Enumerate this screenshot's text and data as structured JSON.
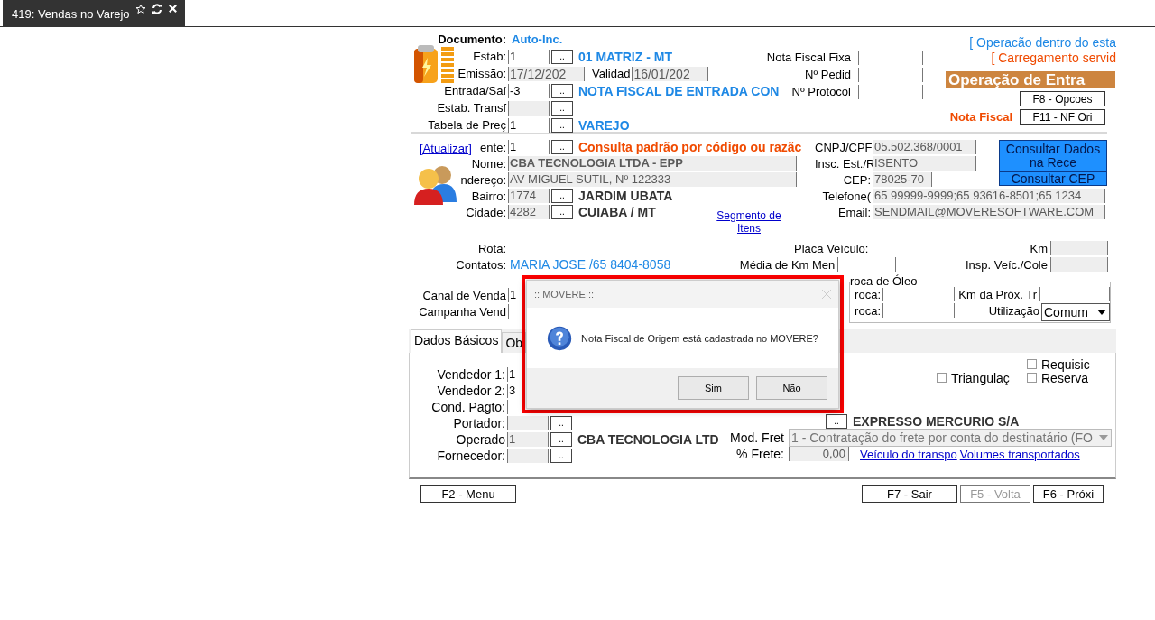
{
  "tab": {
    "title": "419: Vendas no Varejo"
  },
  "document": {
    "label": "Documento:",
    "value": "Auto-Inc."
  },
  "header": {
    "rows": [
      {
        "kind": "lookup",
        "label": "Estab:",
        "value": "1",
        "disabled": false,
        "button": "..",
        "description": "01 MATRIZ - MT",
        "color": "#1e88e5"
      },
      {
        "kind": "pair",
        "label": "Emissão:",
        "value": "17/12/202",
        "disabled": true,
        "label_2": "Validad",
        "value_2": "16/01/202"
      },
      {
        "kind": "lookup",
        "label": "Entrada/Saí",
        "value": "-3",
        "disabled": false,
        "button": "..",
        "description": "NOTA FISCAL DE ENTRADA CON",
        "color": "#1e88e5"
      },
      {
        "kind": "lookup",
        "label": "Estab. Transf",
        "disabled": true,
        "button": ".."
      },
      {
        "kind": "lookup",
        "label": "Tabela de Preç",
        "value": "1",
        "disabled": false,
        "button": "..",
        "description": "VAREJO",
        "color": "#1e88e5"
      }
    ],
    "fiscal_fields": [
      {
        "label": "Nota  Fiscal Fixa"
      },
      {
        "label": "Nº Pedid"
      },
      {
        "label": "Nº Protocol"
      }
    ],
    "notices": [
      {
        "text": "[ Operacão dentro do esta",
        "color": "#1e88e5"
      },
      {
        "text": "[ Carregamento servid",
        "color": "#f04a00"
      }
    ],
    "banner": "Operação de Entra",
    "options_button": "F8 - Opcoes",
    "nf_label": "Nota Fiscal",
    "nf_button": "F11 - NF Ori"
  },
  "customer": {
    "refresh_link": "[Atualizar]",
    "segment_link": "Segmento de Itens",
    "rows": [
      {
        "kind": "lookup",
        "label": "ente:",
        "value": "1",
        "disabled": false,
        "button": "..",
        "description": "Consulta padrão por código ou razãc",
        "color": "#f04a00"
      },
      {
        "kind": "wide",
        "label": "Nome:",
        "value": "CBA TECNOLOGIA LTDA - EPP",
        "disabled": true,
        "bold": true
      },
      {
        "kind": "wide",
        "label": "ndereço:",
        "value": "AV MIGUEL SUTIL, Nº 122333",
        "disabled": true,
        "bold": false
      },
      {
        "kind": "lookup",
        "label": "Bairro:",
        "value": "1774",
        "disabled": true,
        "button": "..",
        "description": "JARDIM UBATA",
        "color": "#333333"
      },
      {
        "kind": "lookup",
        "label": "Cidade:",
        "value": "4282",
        "disabled": true,
        "button": "..",
        "description": "CUIABA / MT",
        "color": "#333333"
      }
    ],
    "id_fields": [
      {
        "label": "CNPJ/CPF",
        "value": "05.502.368/0001",
        "kind": "medium"
      },
      {
        "label": "Insc. Est./R",
        "value": "ISENTO",
        "kind": "medium"
      },
      {
        "label": "CEP:",
        "value": "78025-70",
        "kind": "short"
      },
      {
        "label": "Telefone(",
        "value": "65 99999-9999;65 93616-8501;65 1234",
        "kind": "long"
      },
      {
        "label": "Email:",
        "value": "SENDMAIL@MOVERESOFTWARE.COM",
        "kind": "long"
      }
    ],
    "buttons": [
      "Consultar Dados na Rece",
      "Consultar CEP"
    ]
  },
  "route": {
    "route_label": "Rota:",
    "plate_label": "Placa Veículo:",
    "km_label": "Km",
    "contacts_label": "Contatos:",
    "contacts_value": "MARIA JOSE /65 8404-8058",
    "km_average_label": "Média de Km Men",
    "inspection_label": "Insp. Veíc./Cole"
  },
  "sales": {
    "channel_label": "Canal de Venda",
    "channel_value": "1",
    "campaign_label": "Campanha Vend"
  },
  "oil_change": {
    "title": "roca de Óleo",
    "date_label": "roca:",
    "next_km_label": "Km da Próx. Tr",
    "date_label_2": "roca:",
    "usage_label": "Utilização",
    "usage_value": "Comum"
  },
  "tabs": [
    {
      "label": "Dados Básicos",
      "selected": true
    },
    {
      "label": "Ob",
      "selected": false
    }
  ],
  "basic": {
    "rows": [
      {
        "label": "Vendedor 1:",
        "value": "1"
      },
      {
        "label": "Vendedor 2:",
        "value": "3"
      },
      {
        "label": "Cond. Pagto:"
      },
      {
        "label": "Portador:",
        "button": ".."
      },
      {
        "label": "Operado",
        "value": "1",
        "button": "..",
        "description": "CBA TECNOLOGIA LTD"
      },
      {
        "label": "Fornecedor:",
        "button": ".."
      }
    ],
    "checkbox_rows": [
      [
        {
          "label": "Requisic",
          "checked": false
        }
      ],
      [
        {
          "label": "Triangulaç",
          "checked": false
        },
        {
          "label": "Reserva",
          "checked": false
        }
      ]
    ],
    "carrier_button": "..",
    "carrier": "EXPRESSO MERCURIO S/A",
    "freight_label": "Mod. Fret",
    "freight_value": "1 - Contratação do frete por conta do destinatário (FO",
    "freight_pct_label": "% Frete:",
    "freight_pct": "0,00",
    "links": [
      "Veículo do transpo",
      "Volumes transportados"
    ]
  },
  "footer": [
    {
      "label": "F2 - Menu",
      "disabled": false
    },
    {
      "label": "F7 - Sair",
      "disabled": false
    },
    {
      "label": "F5 - Volta",
      "disabled": true
    },
    {
      "label": "F6 - Próxi",
      "disabled": false
    }
  ],
  "dialog": {
    "title": ":: MOVERE ::",
    "message": "Nota Fiscal de Origem está cadastrada no MOVERE?",
    "buttons": [
      "Sim",
      "Não"
    ]
  }
}
